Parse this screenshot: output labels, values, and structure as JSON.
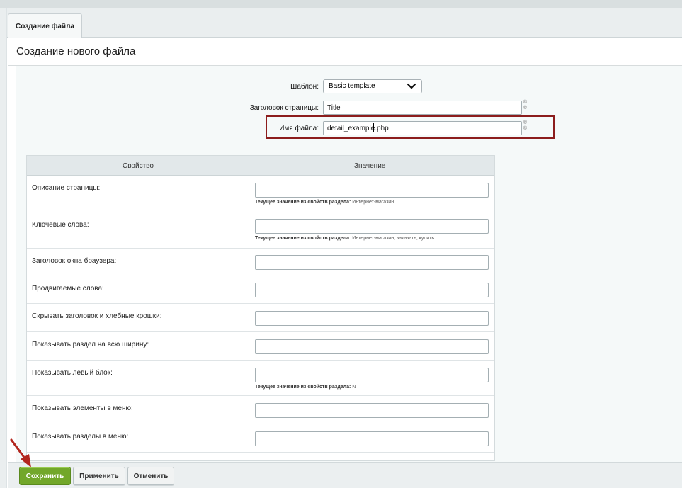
{
  "tab": {
    "label": "Создание файла"
  },
  "page": {
    "title": "Создание нового файла"
  },
  "form": {
    "template_label": "Шаблон:",
    "template_value": "Basic template",
    "page_title_label": "Заголовок страницы:",
    "page_title_value": "Title",
    "filename_label": "Имя файла:",
    "filename_value": "detail_example.php",
    "help_mark": "®"
  },
  "properties": {
    "col_property": "Свойство",
    "col_value": "Значение",
    "note_prefix": "Текущее значение из свойств раздела:",
    "rows": [
      {
        "label": "Описание страницы:",
        "value": "",
        "note": "Интернет-магазин"
      },
      {
        "label": "Ключевые слова:",
        "value": "",
        "note": "Интернет-магазин, заказать, купить"
      },
      {
        "label": "Заголовок окна браузера:",
        "value": ""
      },
      {
        "label": "Продвигаемые слова:",
        "value": ""
      },
      {
        "label": "Скрывать заголовок и хлебные крошки:",
        "value": ""
      },
      {
        "label": "Показывать раздел на всю ширину:",
        "value": ""
      },
      {
        "label": "Показывать левый блок:",
        "value": "",
        "note": "N"
      },
      {
        "label": "Показывать элементы в меню:",
        "value": ""
      },
      {
        "label": "Показывать разделы в меню:",
        "value": ""
      }
    ]
  },
  "buttons": {
    "save": "Сохранить",
    "apply": "Применить",
    "cancel": "Отменить"
  },
  "colors": {
    "save": "#72a72a",
    "highlight": "#8c1d1d",
    "arrow": "#b3261e"
  },
  "icons": {
    "select_arrow": "chevron-down-icon",
    "pointer": "red-arrow-icon"
  }
}
